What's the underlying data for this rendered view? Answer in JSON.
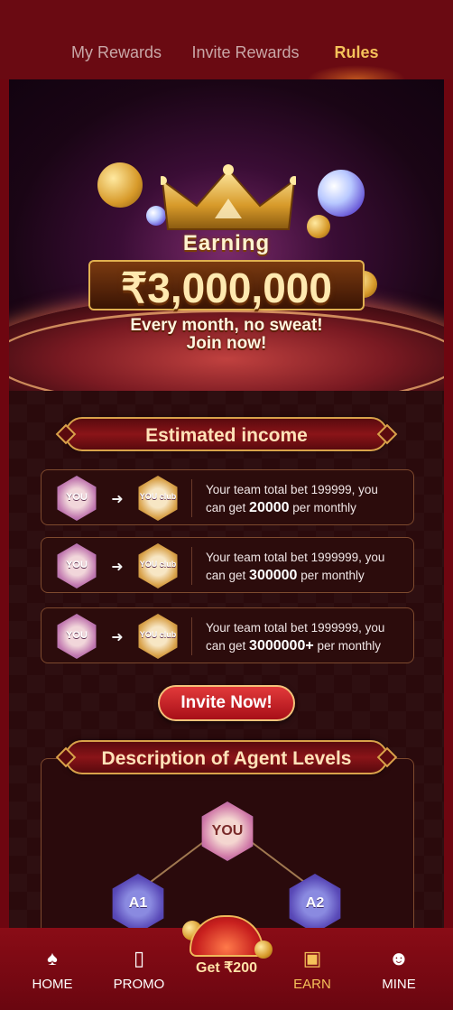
{
  "tabs": [
    {
      "label": "My Rewards",
      "active": false
    },
    {
      "label": "Invite Rewards",
      "active": false
    },
    {
      "label": "Rules",
      "active": true
    }
  ],
  "banner": {
    "earning": "Earning",
    "amount": "₹3,000,000",
    "line1": "Every month, no sweat!",
    "line2": "Join now!"
  },
  "income": {
    "title": "Estimated income",
    "badge_from": "YOU",
    "badge_to": "YOU club",
    "cards": [
      {
        "bet_text": "Your team total bet 199999, you",
        "get_prefix": "can get ",
        "amount": "20000",
        "suffix": " per monthly"
      },
      {
        "bet_text": "Your team total bet 1999999, you",
        "get_prefix": "can get ",
        "amount": "300000",
        "suffix": " per monthly"
      },
      {
        "bet_text": "Your team total bet 1999999, you",
        "get_prefix": "can get ",
        "amount": "3000000+",
        "suffix": " per monthly"
      }
    ]
  },
  "invite_button": "Invite Now!",
  "agent": {
    "title": "Description of Agent Levels",
    "top": "YOU",
    "left": "A1",
    "right": "A2"
  },
  "nav": {
    "items": [
      {
        "label": "HOME",
        "icon": "spade-home-icon"
      },
      {
        "label": "PROMO",
        "icon": "promo-icon"
      },
      {
        "label": "EARN",
        "icon": "gift-icon",
        "active": true
      },
      {
        "label": "MINE",
        "icon": "user-icon"
      }
    ],
    "center": "Get ₹200"
  },
  "colors": {
    "accent": "#f5c15a",
    "background": "#6e0610",
    "panel": "#2a0a0c",
    "button": "#c8201e"
  }
}
